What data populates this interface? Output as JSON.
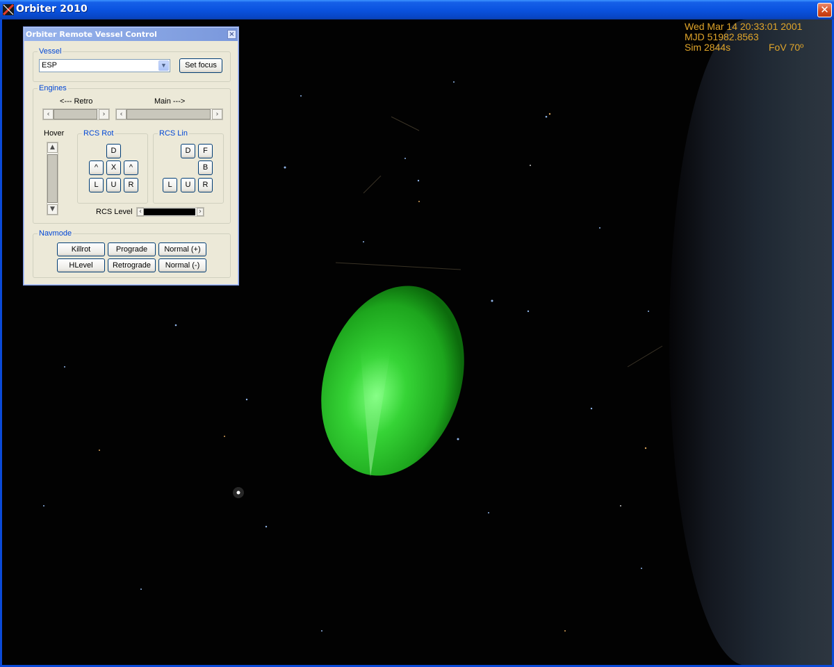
{
  "window": {
    "title": "Orbiter 2010",
    "close_glyph": "✕",
    "icon": "orbiter-logo-icon"
  },
  "hud": {
    "datetime": "Wed Mar 14 20:33:01 2001",
    "mjd": "MJD 51982.8563",
    "sim": "Sim  2844s",
    "fov": "FoV  70º",
    "color": "#e0a52a"
  },
  "dialog": {
    "title": "Orbiter Remote Vessel Control",
    "close_glyph": "×",
    "vessel": {
      "legend": "Vessel",
      "selected": "ESP",
      "set_focus_label": "Set focus"
    },
    "engines": {
      "legend": "Engines",
      "retro_label": "<--- Retro",
      "main_label": "Main --->",
      "hover_label": "Hover",
      "rcs_level_label": "RCS Level",
      "retro_level": 0.0,
      "main_level": 0.0,
      "hover_level": 0.0,
      "rcs_level": 0.0
    },
    "rcs_rot": {
      "legend": "RCS Rot",
      "buttons": [
        "D",
        "^",
        "X",
        "^",
        "L",
        "U",
        "R"
      ]
    },
    "rcs_lin": {
      "legend": "RCS Lin",
      "buttons": [
        "D",
        "F",
        "B",
        "L",
        "U",
        "R"
      ]
    },
    "navmode": {
      "legend": "Navmode",
      "buttons": [
        "Killrot",
        "Prograde",
        "Normal (+)",
        "HLevel",
        "Retrograde",
        "Normal (-)"
      ]
    }
  },
  "scene": {
    "vessel_color": "#2fd42f",
    "accent": "#0046d5"
  }
}
